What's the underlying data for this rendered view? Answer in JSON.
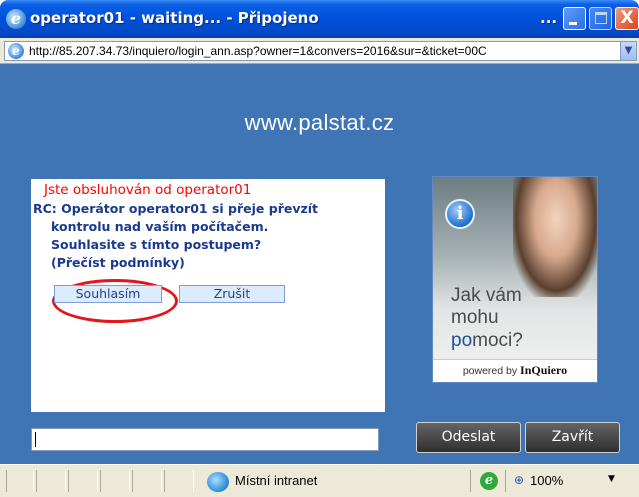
{
  "window": {
    "title": "operator01 - waiting... - Připojeno",
    "title_ellipsis": "...",
    "close_glyph": "X"
  },
  "address_bar": {
    "url": "http://85.207.34.73/inquiero/login_ann.asp?owner=1&convers=2016&sur=&ticket=00C",
    "dropdown_glyph": "▼",
    "ie_glyph": "e"
  },
  "page": {
    "site_title": "www.palstat.cz",
    "chat": {
      "served_by": "Jste obsluhován od operator01",
      "message_lines": [
        "RC: Operátor operator01 si přeje převzít",
        "kontrolu nad vaším počítačem.",
        "Souhlasite s tímto postupem?",
        "(Přečíst podmínky)"
      ],
      "agree_label": "Souhlasím",
      "cancel_label": "Zrušit"
    },
    "ad": {
      "info_glyph": "i",
      "line1": "Jak vám",
      "line2": "mohu",
      "line3_accent": "po",
      "line3_rest": "moci?",
      "footer_prefix": "powered by ",
      "footer_brand": "InQuiero"
    },
    "input": {
      "message_value": ""
    },
    "send_label": "Odeslat",
    "close_label": "Zavřít"
  },
  "status_bar": {
    "zone_text": "Místní intranet",
    "zoom_text": "100%",
    "zoom_icon_glyph": "⊕",
    "ie_glyph": "e",
    "zoom_arrow": "▼"
  },
  "colors": {
    "titlebar": "#0050dc",
    "page_background": "#3f74b5",
    "served_by_text": "#ff0000",
    "message_text": "#1a3a8c",
    "highlight_ring": "#e4141b"
  }
}
